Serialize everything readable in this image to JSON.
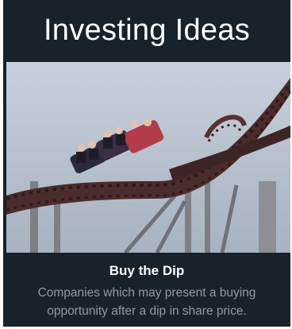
{
  "card": {
    "title": "Investing Ideas",
    "image_description_icon": "roller-coaster-photo",
    "heading": "Buy the Dip",
    "description": "Companies which may present a buying opportunity after a dip in share price."
  },
  "colors": {
    "background": "#17222b",
    "title": "#ffffff",
    "description": "#8f9aa3"
  }
}
